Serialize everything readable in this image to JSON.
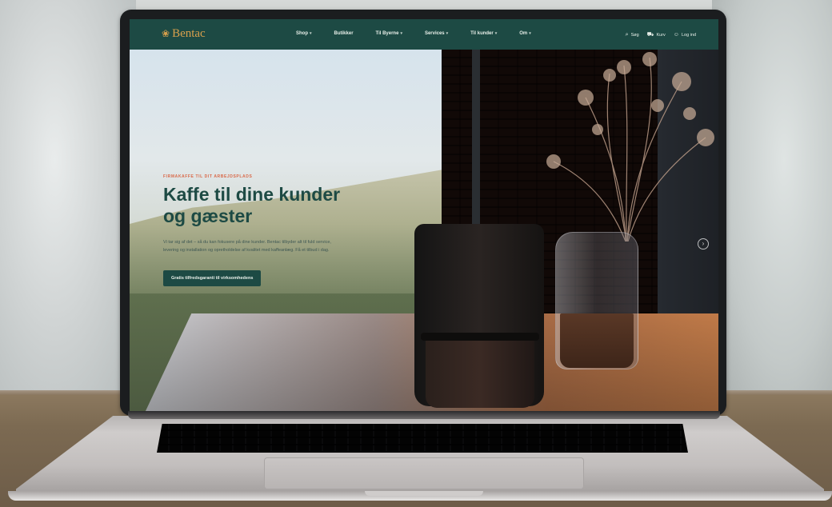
{
  "site": {
    "brand": "Bentac",
    "brand_mark": "❀",
    "nav": [
      {
        "label": "Shop",
        "has_caret": true
      },
      {
        "label": "Butikker",
        "has_caret": false
      },
      {
        "label": "Til Byerne",
        "has_caret": true
      },
      {
        "label": "Services",
        "has_caret": true
      },
      {
        "label": "Til kunder",
        "has_caret": true
      },
      {
        "label": "Om",
        "has_caret": true
      }
    ],
    "utilities": [
      {
        "icon": "search-icon",
        "glyph": "⌕",
        "label": "Søg"
      },
      {
        "icon": "cart-icon",
        "glyph": "⛟",
        "label": "Kurv"
      },
      {
        "icon": "user-icon",
        "glyph": "☺",
        "label": "Log ind"
      }
    ]
  },
  "hero": {
    "eyebrow": "FIRMAKAFFE TIL DIT ARBEJDSPLADS",
    "headline": "Kaffe til dine kunder og gæster",
    "body": "Vi tar sig af det – så du kan fokusere på dine kunder. Bentac tilbyder alt til fuld service, levering og installation og opretholdelse af kvalitet med kaffeanlæg. Få et tilbud i dag.",
    "cta": "Gratis tilfredsgaranti til virksomhedens",
    "next_glyph": "›"
  },
  "colors": {
    "nav_bg": "#1d4a44",
    "brand_gold": "#d9a04c",
    "accent_orange": "#d96a4a",
    "headline": "#1d4a44"
  }
}
